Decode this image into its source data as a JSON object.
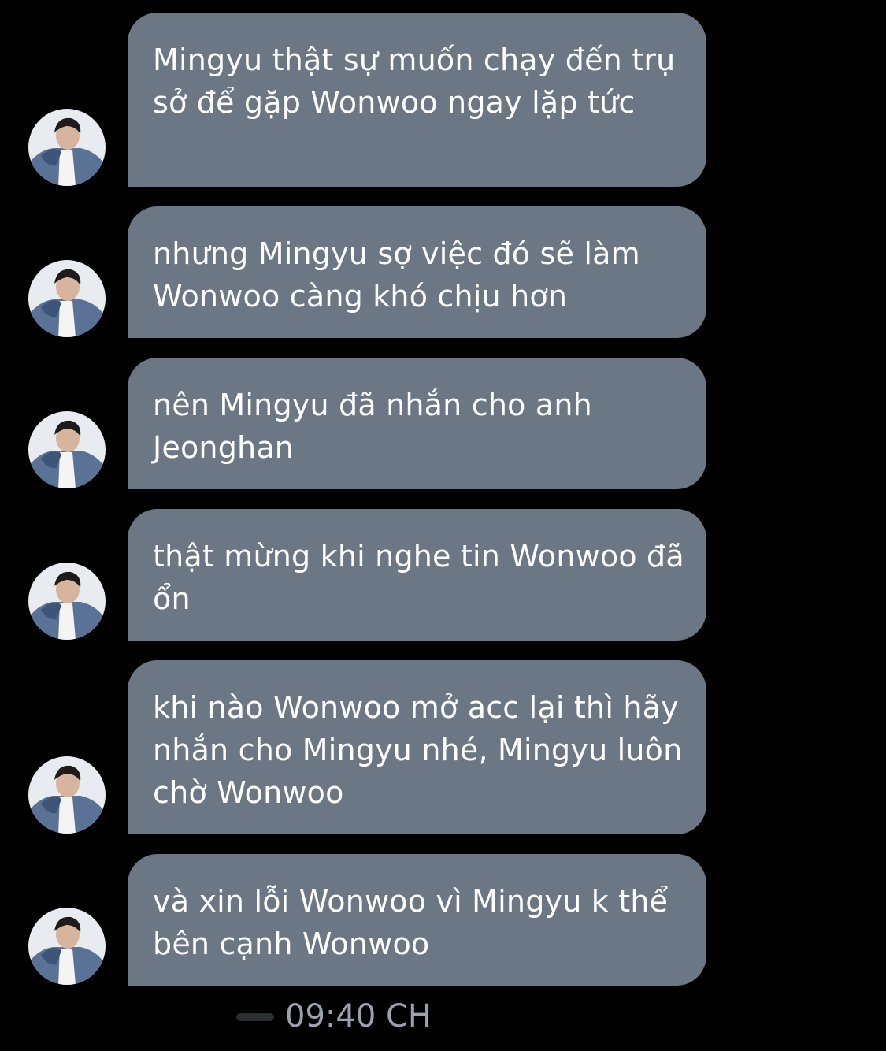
{
  "messages": [
    {
      "text": "Mingyu thật sự muốn chạy đến trụ sở để gặp Wonwoo ngay lặp tức"
    },
    {
      "text": "nhưng Mingyu sợ việc đó sẽ làm Wonwoo càng khó chịu hơn"
    },
    {
      "text": "nên Mingyu đã nhắn cho anh Jeonghan"
    },
    {
      "text": "thật mừng khi nghe tin Wonwoo đã ổn"
    },
    {
      "text": "khi nào Wonwoo mở acc lại thì hãy nhắn cho Mingyu nhé, Mingyu luôn chờ Wonwoo"
    },
    {
      "text": "và xin lỗi Wonwoo vì Mingyu k thể bên cạnh Wonwoo"
    }
  ],
  "timestamp": "09:40 CH",
  "colors": {
    "background": "#000000",
    "bubble": "#6b7785",
    "bubble_text": "#ffffff",
    "timestamp_text": "#9aa3ad"
  },
  "icons": {
    "avatar": "user-avatar-photo"
  }
}
